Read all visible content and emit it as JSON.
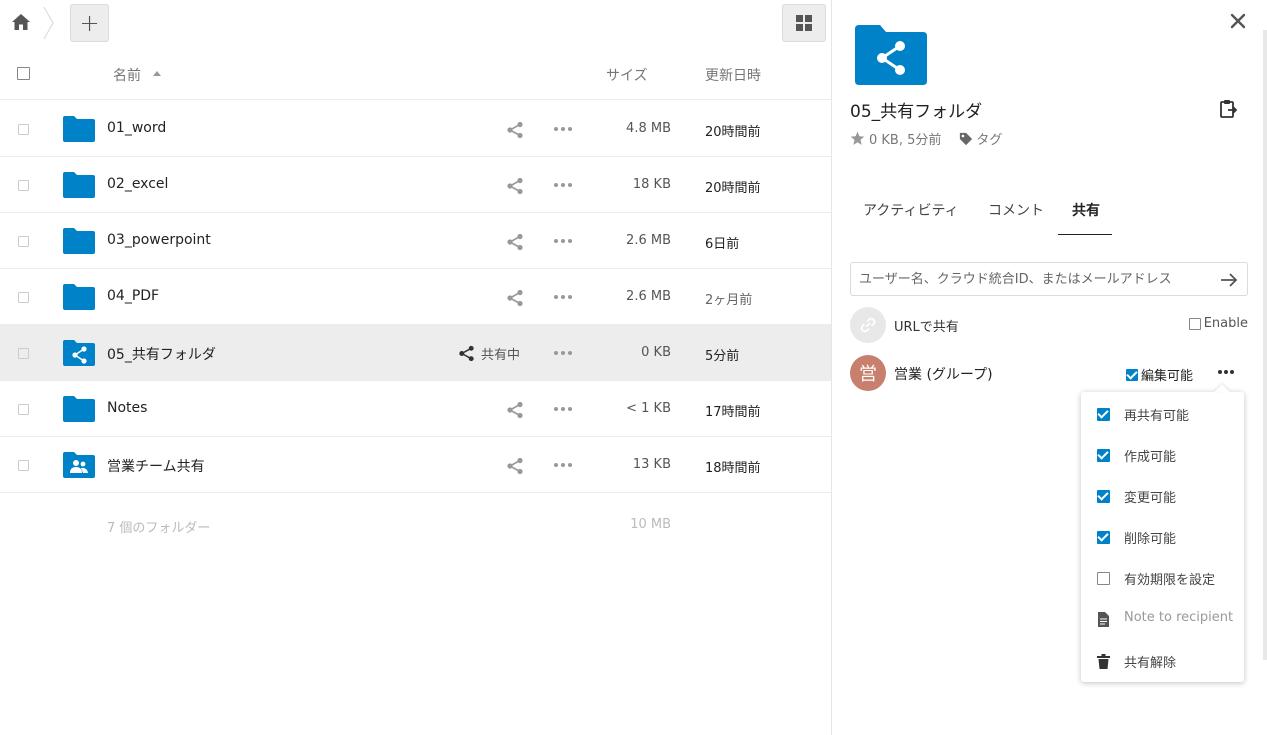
{
  "toolbar": {
    "add_label": "+"
  },
  "list_header": {
    "name": "名前",
    "size": "サイズ",
    "modified": "更新日時"
  },
  "files": [
    {
      "name": "01_word",
      "size": "4.8 MB",
      "modified": "20時間前",
      "type": "folder"
    },
    {
      "name": "02_excel",
      "size": "18 KB",
      "modified": "20時間前",
      "type": "folder"
    },
    {
      "name": "03_powerpoint",
      "size": "2.6 MB",
      "modified": "6日前",
      "type": "folder"
    },
    {
      "name": "04_PDF",
      "size": "2.6 MB",
      "modified": "2ヶ月前",
      "type": "folder"
    },
    {
      "name": "05_共有フォルダ",
      "size": "0 KB",
      "modified": "5分前",
      "type": "shared-folder",
      "shared_label": "共有中"
    },
    {
      "name": "Notes",
      "size": "< 1 KB",
      "modified": "17時間前",
      "type": "folder"
    },
    {
      "name": "営業チーム共有",
      "size": "13 KB",
      "modified": "18時間前",
      "type": "group-folder"
    }
  ],
  "summary": {
    "count": "7 個のフォルダー",
    "total": "10 MB"
  },
  "sidebar": {
    "title": "05_共有フォルダ",
    "meta": "0 KB, 5分前",
    "tags_label": "タグ",
    "tabs": [
      {
        "label": "アクティビティ"
      },
      {
        "label": "コメント"
      },
      {
        "label": "共有"
      }
    ],
    "share_placeholder": "ユーザー名、クラウド統合ID、またはメールアドレス",
    "link_share": {
      "label": "URLで共有",
      "enable_label": "Enable"
    },
    "group_share": {
      "avatar_letter": "営",
      "name": "営業 (グループ)",
      "edit_label": "編集可能"
    },
    "menu": [
      {
        "label": "再共有可能",
        "icon": "checkbox-checked"
      },
      {
        "label": "作成可能",
        "icon": "checkbox-checked"
      },
      {
        "label": "変更可能",
        "icon": "checkbox-checked"
      },
      {
        "label": "削除可能",
        "icon": "checkbox-checked"
      },
      {
        "label": "有効期限を設定",
        "icon": "checkbox-empty"
      },
      {
        "label": "Note to recipient",
        "icon": "note-icon"
      },
      {
        "label": "共有解除",
        "icon": "trash-icon"
      }
    ]
  },
  "colors": {
    "folder": "#0082c9",
    "selected_row": "#ededed",
    "group_avatar": "#c97f6d"
  }
}
